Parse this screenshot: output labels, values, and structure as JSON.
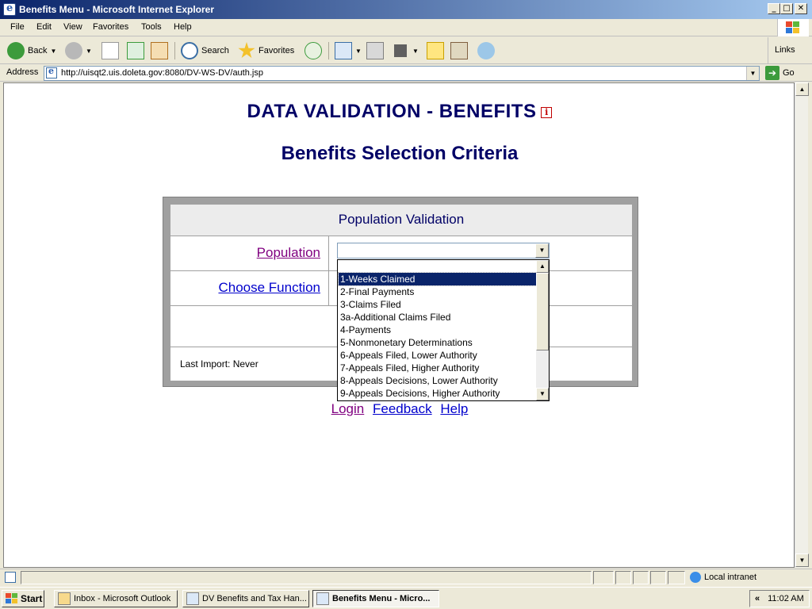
{
  "window": {
    "title": "Benefits Menu - Microsoft Internet Explorer",
    "buttons": [
      "_",
      "□",
      "✕"
    ]
  },
  "menu": [
    "File",
    "Edit",
    "View",
    "Favorites",
    "Tools",
    "Help"
  ],
  "toolbar": {
    "back": "Back",
    "search": "Search",
    "favorites": "Favorites",
    "links": "Links"
  },
  "address": {
    "label": "Address",
    "url": "http://uisqt2.uis.doleta.gov:8080/DV-WS-DV/auth.jsp",
    "go": "Go"
  },
  "page": {
    "title": "DATA VALIDATION - BENEFITS",
    "info_icon": "i",
    "subtitle": "Benefits Selection Criteria",
    "panel_header": "Population Validation",
    "population_label": "Population",
    "choose_function_label": "Choose Function",
    "last_import": "Last Import: Never",
    "population_select": {
      "value": "",
      "options": [
        "",
        "1-Weeks Claimed",
        "2-Final Payments",
        "3-Claims Filed",
        "3a-Additional Claims Filed",
        "4-Payments",
        "5-Nonmonetary Determinations",
        "6-Appeals Filed, Lower Authority",
        "7-Appeals Filed, Higher Authority",
        "8-Appeals Decisions, Lower Authority",
        "9-Appeals Decisions, Higher Authority"
      ],
      "highlighted": "1-Weeks Claimed"
    },
    "footer_links": [
      "Login",
      "Feedback",
      "Help"
    ]
  },
  "statusbar": {
    "zone": "Local intranet"
  },
  "taskbar": {
    "start": "Start",
    "tasks": [
      "Inbox - Microsoft Outlook",
      "DV Benefits and Tax Han...",
      "Benefits Menu - Micro..."
    ],
    "tray_chevron": "«",
    "clock": "11:02 AM"
  }
}
